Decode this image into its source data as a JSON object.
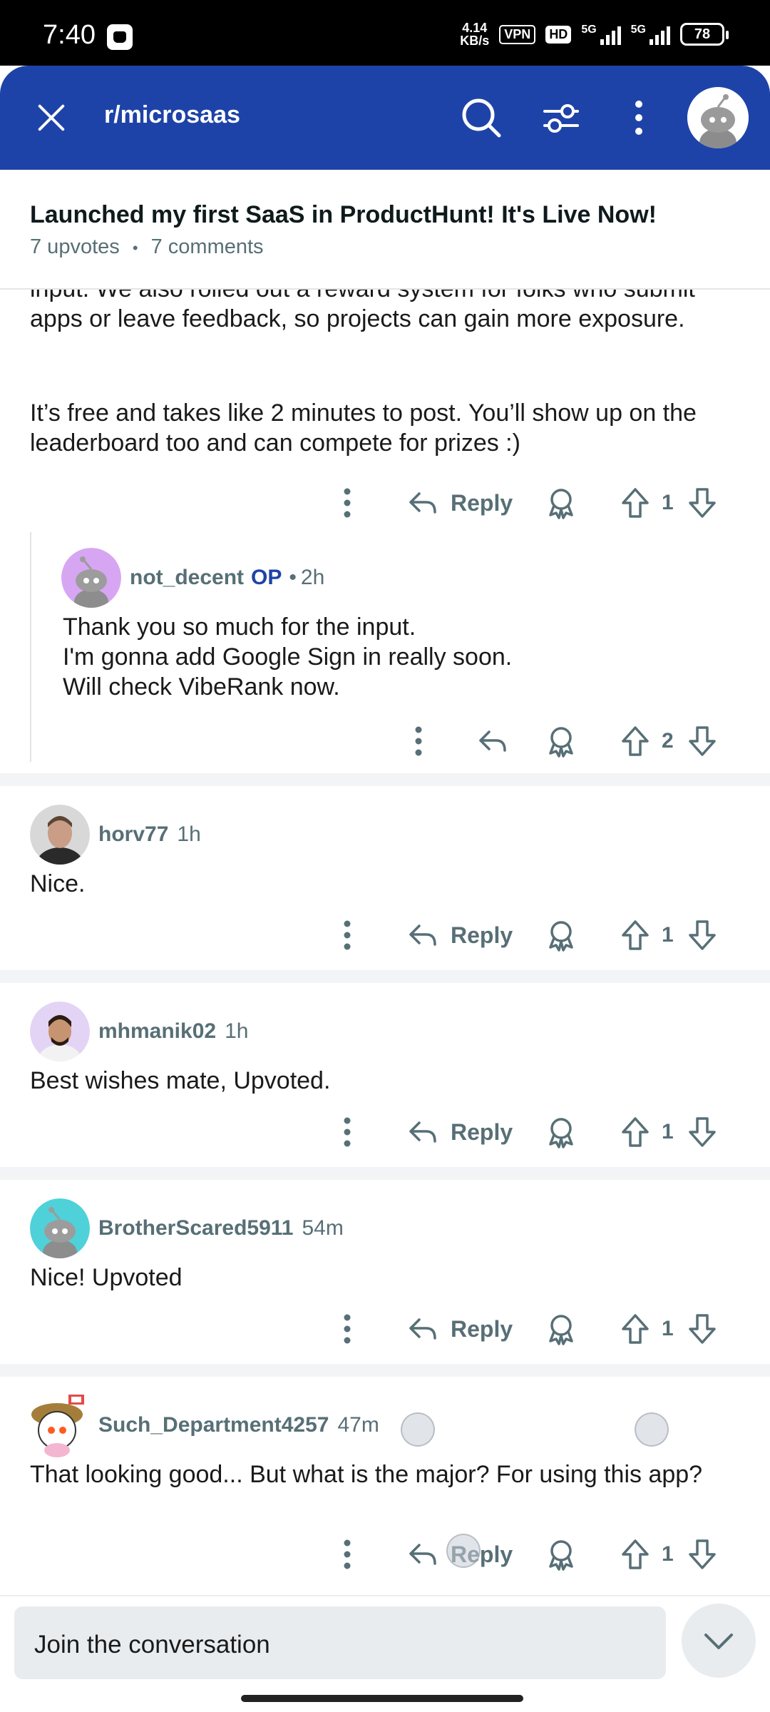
{
  "status_bar": {
    "time": "7:40",
    "net_speed_value": "4.14",
    "net_speed_unit": "KB/s",
    "vpn": "VPN",
    "hd": "HD",
    "signal1": "5G",
    "signal2": "5G",
    "battery": "78"
  },
  "header": {
    "subreddit": "r/microsaas",
    "accent_color": "#1e43a8"
  },
  "post": {
    "title": "Launched my first SaaS in ProductHunt! It's Live Now!",
    "upvotes": "7 upvotes",
    "separator": "•",
    "comments": "7 comments"
  },
  "thread": {
    "partial_text_1": "input. We also rolled out a reward system for folks who submit apps or leave feedback, so projects can gain more exposure.",
    "partial_text_2": "It’s free and takes like 2 minutes to post. You’ll show up on the leaderboard too and can compete for prizes :)",
    "reply_label": "Reply",
    "votes_top": "1",
    "reply": {
      "author": "not_decent",
      "op_tag": "OP",
      "dot": "•",
      "time": "2h",
      "body": "Thank you so much for the input.\nI'm gonna add Google Sign in really soon.\nWill check VibeRank now.",
      "votes": "2"
    }
  },
  "comments": [
    {
      "author": "horv77",
      "time": "1h",
      "body": "Nice.",
      "reply_label": "Reply",
      "votes": "1"
    },
    {
      "author": "mhmanik02",
      "time": "1h",
      "body": "Best wishes mate, Upvoted.",
      "reply_label": "Reply",
      "votes": "1"
    },
    {
      "author": "BrotherScared5911",
      "time": "54m",
      "body": "Nice! Upvoted",
      "reply_label": "Reply",
      "votes": "1"
    },
    {
      "author": "Such_Department4257",
      "time": "47m",
      "body": "That looking good... But what is the major? For using this app?",
      "reply_label": "Reply",
      "votes": "1"
    }
  ],
  "bottom_bar": {
    "placeholder": "Join the conversation"
  },
  "icons": {
    "close": "close-icon",
    "search": "search-icon",
    "filter": "filter-icon",
    "more": "more-vertical-icon",
    "reply": "reply-arrow-icon",
    "award": "award-icon",
    "upvote": "upvote-arrow-icon",
    "downvote": "downvote-arrow-icon",
    "collapse": "chevron-down-icon"
  }
}
